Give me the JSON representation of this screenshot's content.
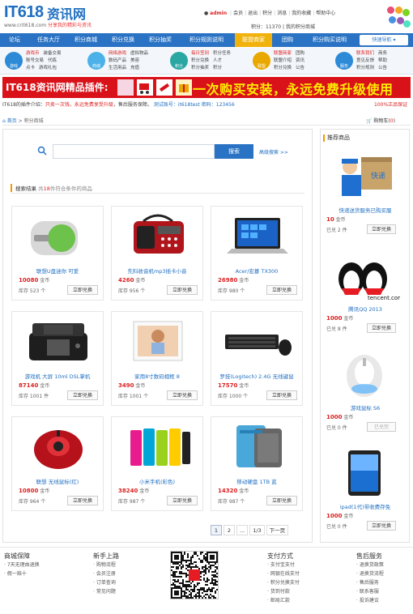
{
  "header": {
    "logo_it": "IT618",
    "logo_cn": "资讯网",
    "logo_url": "www.crit618.com",
    "logo_slogan": "分享我的精彩与资讯",
    "user": "admin",
    "toplinks": [
      "会员",
      "退出",
      "积分",
      "消息",
      "我的收藏",
      "帮助中心"
    ],
    "shop_label": "购物车",
    "search_label": "积分：11370",
    "search_link": "我的积分商城"
  },
  "nav": {
    "items": [
      "论坛",
      "任务大厅",
      "积分商城",
      "积分兑换",
      "积分抽奖",
      "积分规则说明",
      "联盟商家",
      "团购",
      "积分购买说明"
    ],
    "hot_index": 6,
    "quick_button": "快速导航 ▾"
  },
  "subnav": [
    {
      "icon_label": "游戏",
      "color": "#2d8ad6",
      "links": [
        [
          "游戏币",
          "装备交易"
        ],
        [
          "账号交易",
          "代练"
        ],
        [
          "点卡",
          "游戏礼包"
        ]
      ]
    },
    {
      "icon_label": "商城",
      "color": "#4bb1e8",
      "links": [
        [
          "网络游戏",
          "虚拟物品"
        ],
        [
          "数码产品",
          "美容"
        ],
        [
          "生活用品",
          "充值"
        ]
      ]
    },
    {
      "icon_label": "积分",
      "color": "#2aa6a3",
      "links": [
        [
          "每日签到",
          "积分任务"
        ],
        [
          "积分兑换",
          "人才"
        ],
        [
          "积分抽奖",
          "积分"
        ]
      ]
    },
    {
      "icon_label": "联盟",
      "color": "#e9a800",
      "links": [
        [
          "联盟商家",
          "团购"
        ],
        [
          "联盟介绍",
          "资讯"
        ],
        [
          "积分兑换",
          "公告"
        ]
      ]
    },
    {
      "icon_label": "服务",
      "color": "#2d8ad6",
      "links": [
        [
          "联系我们",
          "商务"
        ],
        [
          "意见反馈",
          "帮助"
        ],
        [
          "积分规则",
          "公告"
        ]
      ]
    }
  ],
  "banner": {
    "title": "IT618资讯网精品插件:",
    "slogan": "一次购买安装，永远免费升级使用"
  },
  "infoline": {
    "prefix": "IT618的插件介绍：",
    "highlight": "只卖一次钱，永远免费享受升级",
    "middle": "，售后服务保障。",
    "link": "测试账号：it618test 密码：123456"
  },
  "inforight": "100%正品保证",
  "breadcrumb": {
    "home": "首页",
    "sep": " > ",
    "current": "积分商城"
  },
  "cart_label": "购物车",
  "cart_count": "0",
  "search": {
    "placeholder": "",
    "button": "搜索",
    "adv_link": "高级搜索 >>"
  },
  "results": {
    "label": "搜索结果",
    "count_prefix": "共",
    "count": "18",
    "count_suffix": "件符合条件的商品"
  },
  "products": [
    {
      "name": "联想U盘迷你 可爱",
      "price": "10080",
      "unit": "金币",
      "stock": "库存 523 个",
      "btn": "立即兑换",
      "img": "usb"
    },
    {
      "name": "先科收音机mp3插卡小音",
      "price": "4260",
      "unit": "金币",
      "stock": "库存 956 个",
      "btn": "立即兑换",
      "img": "radio"
    },
    {
      "name": "Acer/宏碁 TX300",
      "price": "26980",
      "unit": "金币",
      "stock": "库存 980 个",
      "btn": "立即兑换",
      "img": "laptop"
    },
    {
      "name": "游戏机 大屏 10ml DSL掌机",
      "price": "87140",
      "unit": "金币",
      "stock": "库存 1001 件",
      "btn": "立即兑换",
      "img": "ds"
    },
    {
      "name": "家用8寸数码相框 8",
      "price": "3490",
      "unit": "金币",
      "stock": "库存 1001 个",
      "btn": "立即兑换",
      "img": "frame"
    },
    {
      "name": "罗技(Logitech) 2.4G 无线键鼠",
      "price": "17570",
      "unit": "金币",
      "stock": "库存 1000 个",
      "btn": "立即兑换",
      "img": "keyboard"
    },
    {
      "name": "联想 无线鼠标(红)",
      "price": "10800",
      "unit": "金币",
      "stock": "库存 964 个",
      "btn": "立即兑换",
      "img": "mouse"
    },
    {
      "name": "小米手机(彩色)",
      "price": "38240",
      "unit": "金币",
      "stock": "库存 987 个",
      "btn": "立即兑换",
      "img": "phones"
    },
    {
      "name": "移动硬盘 1TB 蓝",
      "price": "14320",
      "unit": "金币",
      "stock": "库存 987 个",
      "btn": "立即兑换",
      "img": "hdd"
    }
  ],
  "pager": [
    "1",
    "2",
    "...",
    "1/3",
    "下一页"
  ],
  "sidebar": {
    "title": "推荐商品",
    "items": [
      {
        "name": "快递送货服务已购买服",
        "price": "10",
        "unit": "金币",
        "stock": "已兑 2 件",
        "btn": "立即兑换",
        "img": "courier"
      },
      {
        "name": "腾讯QQ 2013",
        "price": "1000",
        "unit": "金币",
        "stock": "已兑 8 件",
        "btn": "立即兑换",
        "img": "qq"
      },
      {
        "name": "游戏鼠标 S6",
        "price": "1000",
        "unit": "金币",
        "stock": "已兑 0 件",
        "btn": "已兑完",
        "img": "gmouse"
      },
      {
        "name": "ipad(1代)带收费存免",
        "price": "1000",
        "unit": "金币",
        "stock": "已兑 0 件",
        "btn": "立即兑换",
        "img": "ipad"
      }
    ]
  },
  "footer": {
    "cols": [
      {
        "title": "商城保障",
        "links": [
          "7天无理由退换",
          "假一赔十"
        ]
      },
      {
        "title": "新手上路",
        "links": [
          "购物流程",
          "会员注册",
          "订单查询",
          "常见问题"
        ]
      },
      {
        "title": "支付方式",
        "links": [
          "支付宝支付",
          "网银在线支付",
          "积分兑换支付",
          "货到付款",
          "邮局汇款"
        ]
      },
      {
        "title": "售后服务",
        "links": [
          "退换货政策",
          "退换货流程",
          "售后服务",
          "联系客服",
          "投诉建议"
        ]
      }
    ]
  }
}
